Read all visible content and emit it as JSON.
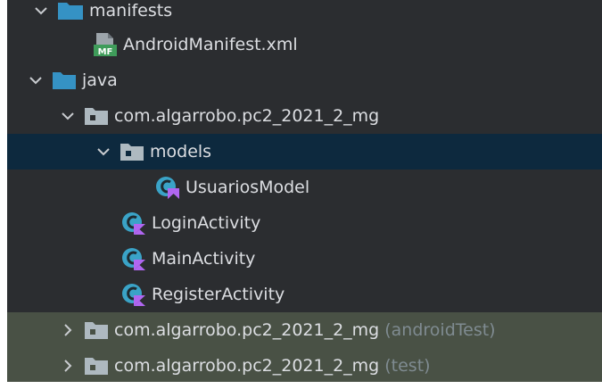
{
  "tree": {
    "manifests_label": "manifests",
    "manifest_file_label": "AndroidManifest.xml",
    "manifest_badge": "MF",
    "java_label": "java",
    "package_label": "com.algarrobo.pc2_2021_2_mg",
    "models_label": "models",
    "usuarios_model_label": "UsuariosModel",
    "login_activity_label": "LoginActivity",
    "main_activity_label": "MainActivity",
    "register_activity_label": "RegisterActivity",
    "android_test_package_label": "com.algarrobo.pc2_2021_2_mg",
    "android_test_suffix": "(androidTest)",
    "test_package_label": "com.algarrobo.pc2_2021_2_mg",
    "test_suffix": "(test)"
  },
  "colors": {
    "panel_bg": "#2b2d30",
    "selected_row": "#0d293e",
    "test_row": "#495145",
    "folder_blue": "#3592c4",
    "package_gray": "#aeb9c0",
    "kotlin_purple": "#b066f0",
    "class_teal": "#3aa3c7"
  }
}
